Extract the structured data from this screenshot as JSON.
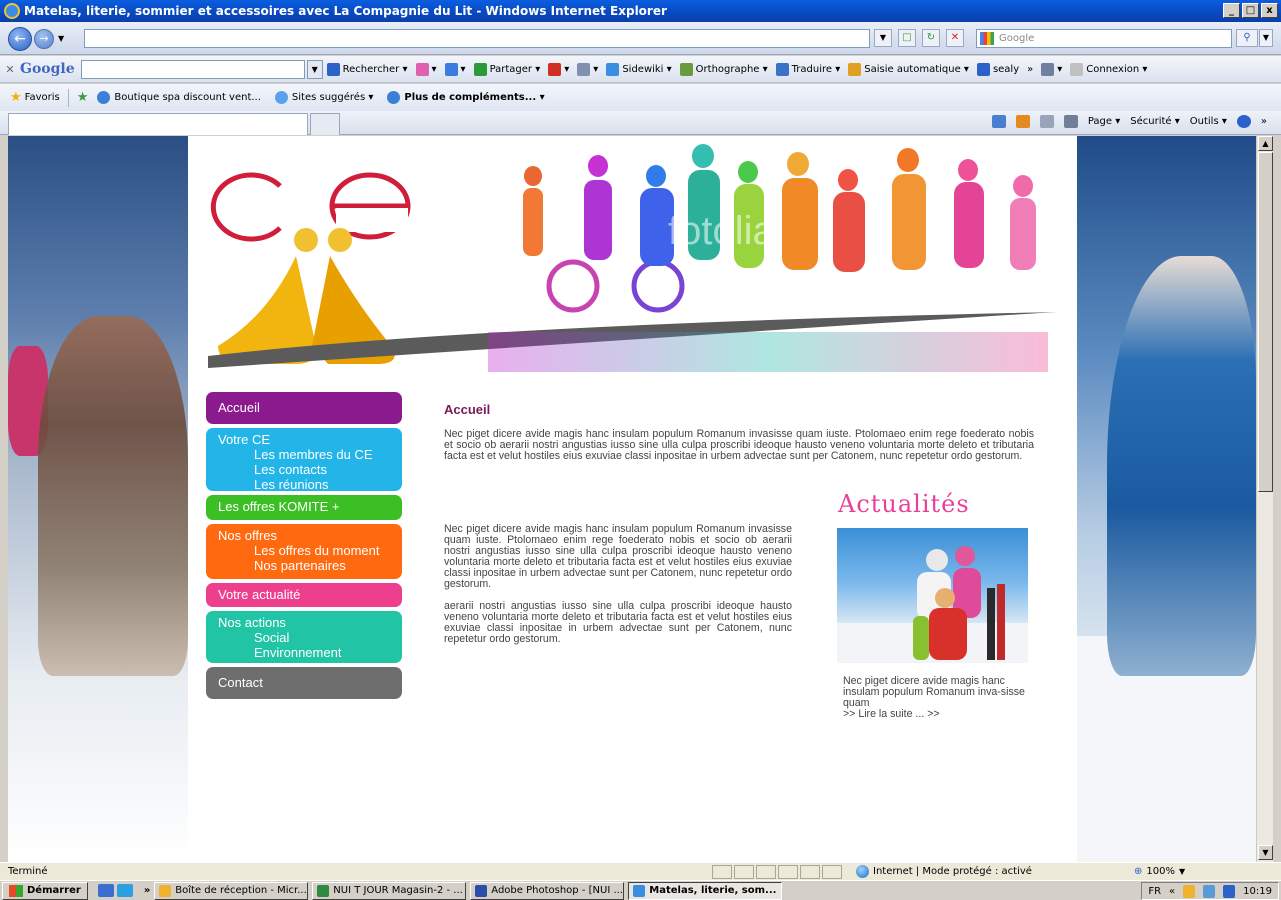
{
  "window": {
    "title": "Matelas, literie, sommier et accessoires avec La Compagnie du Lit - Windows Internet Explorer",
    "controls": [
      "_",
      "□",
      "x"
    ]
  },
  "addressbar": {
    "url": "",
    "search_placeholder": "Google"
  },
  "google_toolbar": {
    "logo": "Google",
    "search_value": "",
    "items": [
      {
        "label": "Rechercher ▾",
        "icon": "search-icon",
        "color": "#2a62c8"
      },
      {
        "label": "▾",
        "icon": "flower-icon",
        "color": "#e060b0"
      },
      {
        "label": "▾",
        "icon": "plus-icon",
        "color": "#3c7be0"
      },
      {
        "label": "Partager ▾",
        "icon": "share-icon",
        "color": "#2c9a3a"
      },
      {
        "label": "▾",
        "icon": "block-icon",
        "color": "#d03020"
      },
      {
        "label": "▾",
        "icon": "rectangle-icon",
        "color": "#8090b0"
      },
      {
        "label": "Sidewiki ▾",
        "icon": "pen-icon",
        "color": "#3b8de0"
      },
      {
        "label": "Orthographe ▾",
        "icon": "abc-icon",
        "color": "#6a9a40"
      },
      {
        "label": "Traduire ▾",
        "icon": "translate-icon",
        "color": "#3a72c8"
      },
      {
        "label": "Saisie automatique ▾",
        "icon": "autofill-icon",
        "color": "#e0a020"
      },
      {
        "label": "sealy",
        "icon": "sealy-icon",
        "color": "#2a62c8"
      },
      {
        "label": "»",
        "icon": "",
        "color": ""
      },
      {
        "label": "▾",
        "icon": "wrench-icon",
        "color": "#7080a0"
      },
      {
        "label": "Connexion ▾",
        "icon": "login-icon",
        "color": "#c0c0c0"
      }
    ]
  },
  "favorites": {
    "label": "Favoris",
    "items": [
      {
        "label": "Boutique spa discount  vent..."
      },
      {
        "label": "Sites suggérés ▾"
      },
      {
        "label": "Plus de compléments... ▾"
      }
    ]
  },
  "commandbar": {
    "items": [
      "Page ▾",
      "Sécurité ▾",
      "Outils ▾",
      "»"
    ]
  },
  "site": {
    "logo_text": "ce",
    "watermark": "fotolia",
    "menu": [
      {
        "label": "Accueil",
        "color": "#8b1a8e",
        "subs": []
      },
      {
        "label": "Votre CE",
        "color": "#23b5e8",
        "subs": [
          "Les membres du CE",
          "Les contacts",
          "Les réunions"
        ]
      },
      {
        "label": "Les offres KOMITE +",
        "color": "#3cbf25",
        "subs": []
      },
      {
        "label": "Nos offres",
        "color": "#ff6a10",
        "subs": [
          "Les offres du moment",
          "Nos partenaires"
        ]
      },
      {
        "label": "Votre actualité",
        "color": "#ee3f8f",
        "subs": []
      },
      {
        "label": "Nos actions",
        "color": "#22c4a6",
        "subs": [
          "Social",
          "Environnement"
        ]
      },
      {
        "label": "Contact",
        "color": "#6e6e6e",
        "subs": []
      }
    ],
    "heading": "Accueil",
    "intro": "Nec piget dicere avide magis hanc insulam populum Romanum invasisse quam iuste. Ptolomaeo enim rege foederato nobis et socio ob aerarii nostri angustias iusso sine ulla culpa proscribi ideoque hausto veneno voluntaria morte deleto et tributaria facta est et velut hostiles eius exuviae classi inpositae in urbem advectae sunt per Catonem, nunc repetetur ordo gestorum.",
    "para1": "Nec piget dicere avide magis hanc insulam populum Romanum invasisse quam iuste. Ptolomaeo enim rege foederato nobis et socio ob aerarii nostri angustias iusso sine ulla culpa proscribi ideoque hausto veneno voluntaria morte deleto et tributaria facta est et velut hostiles eius exuviae classi inpositae in urbem advectae sunt per Catonem, nunc repetetur ordo gestorum.",
    "para2": "aerarii nostri angustias iusso sine ulla culpa proscribi ideoque hausto veneno voluntaria morte deleto et tributaria facta est et velut hostiles eius exuviae classi inpositae in urbem advectae sunt per Catonem, nunc repetetur ordo gestorum.",
    "actu_title": "Actualités",
    "actu_text": "Nec piget dicere avide magis hanc insulam populum Romanum inva-sisse quam",
    "actu_link": ">> Lire la suite ... >>"
  },
  "statusbar": {
    "text": "Terminé",
    "zone": "Internet | Mode protégé : activé",
    "zoom": "100%"
  },
  "taskbar": {
    "start": "Démarrer",
    "tasks": [
      {
        "label": "Boîte de réception - Micr...",
        "color": "#f0b030",
        "active": false
      },
      {
        "label": "NUI T JOUR Magasin-2 - ...",
        "color": "#2e8a3e",
        "active": false
      },
      {
        "label": "Adobe Photoshop - [NUI ...",
        "color": "#2a4fa8",
        "active": false
      },
      {
        "label": "Matelas, literie, som...",
        "color": "#3b8de0",
        "active": true
      }
    ],
    "lang": "FR",
    "time": "10:19"
  }
}
